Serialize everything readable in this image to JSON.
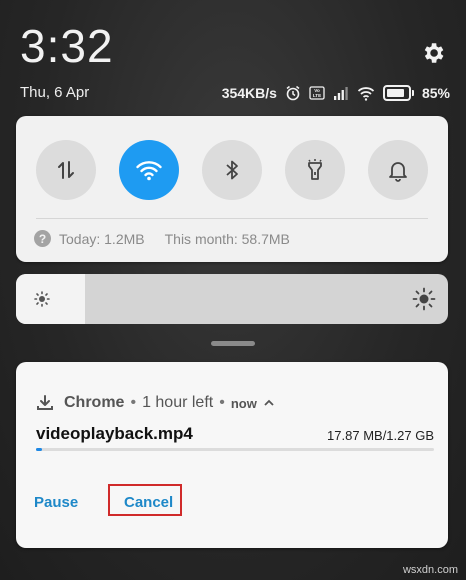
{
  "status_bar": {
    "time": "3:32",
    "date": "Thu, 6 Apr",
    "net_speed": "354KB/s",
    "volte": "VoLTE",
    "battery_percent_text": "85%",
    "battery_level": 0.85
  },
  "quick_settings": {
    "toggles": [
      {
        "name": "mobile-data",
        "icon": "data-transfer-icon",
        "active": false
      },
      {
        "name": "wifi",
        "icon": "wifi-icon",
        "active": true
      },
      {
        "name": "bluetooth",
        "icon": "bluetooth-icon",
        "active": false
      },
      {
        "name": "flashlight",
        "icon": "flashlight-icon",
        "active": false
      },
      {
        "name": "sound",
        "icon": "bell-icon",
        "active": false
      }
    ],
    "data_usage": {
      "today": "Today: 1.2MB",
      "month": "This month: 58.7MB"
    },
    "accent_color": "#1e9bf2"
  },
  "brightness": {
    "level": 0.16
  },
  "notification": {
    "app": "Chrome",
    "remaining": "1 hour left",
    "time": "now",
    "file_name": "videoplayback.mp4",
    "size_text": "17.87 MB/1.27 GB",
    "progress": 0.014,
    "actions": {
      "pause": "Pause",
      "cancel": "Cancel"
    },
    "highlight_color": "#d02a2a"
  },
  "watermark": "wsxdn.com"
}
